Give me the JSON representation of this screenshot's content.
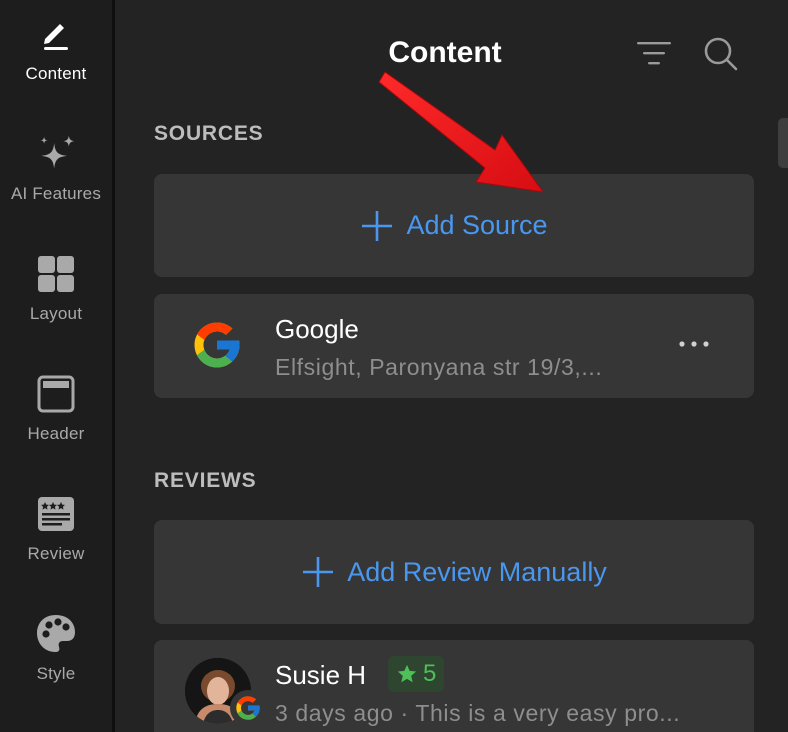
{
  "sidebar": {
    "items": [
      {
        "label": "Content",
        "icon": "pen-icon",
        "active": true
      },
      {
        "label": "AI Features",
        "icon": "sparkles-icon",
        "active": false
      },
      {
        "label": "Layout",
        "icon": "grid-icon",
        "active": false
      },
      {
        "label": "Header",
        "icon": "header-icon",
        "active": false
      },
      {
        "label": "Review",
        "icon": "review-card-icon",
        "active": false
      },
      {
        "label": "Style",
        "icon": "palette-icon",
        "active": false
      }
    ]
  },
  "header": {
    "title": "Content",
    "filter_icon": "filter-icon",
    "search_icon": "search-icon"
  },
  "sources": {
    "heading": "SOURCES",
    "add_label": "Add Source",
    "items": [
      {
        "name": "Google",
        "address": "Elfsight, Paronyana str 19/3,...",
        "logo": "google-logo-icon"
      }
    ]
  },
  "reviews": {
    "heading": "REVIEWS",
    "add_label": "Add Review Manually",
    "items": [
      {
        "name": "Susie H",
        "rating": "5",
        "meta": "3 days ago · This is a very easy pro..."
      }
    ]
  },
  "colors": {
    "accent": "#4a97f0",
    "rating_green": "#4fbf5a",
    "annotation_arrow": "#e8141a"
  }
}
